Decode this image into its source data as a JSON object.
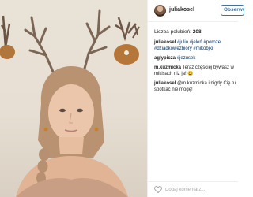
{
  "post": {
    "username": "juliakosel",
    "follow_label": "Obserwuj",
    "likes_label": "Liczba polubień:",
    "likes_count": "208",
    "photo_icon": "portrait-with-antlers-photo"
  },
  "comments": [
    {
      "user": "juliakosel",
      "text": "#julio #jeleń #poroże #dziadkowezbiory #mikobjki"
    },
    {
      "user": "aglypicza",
      "text": "#jezusek"
    },
    {
      "user": "m.kuzmicka",
      "text": "Teraz częściej bywasz w mikisach niż ja! 😄"
    },
    {
      "user": "juliakosel",
      "text": "@m.kuzmicka i nigdy Cię tu spotkać nie mogę!"
    }
  ],
  "comment_box": {
    "placeholder": "Dodaj komentarz...",
    "icon": "heart-icon"
  }
}
